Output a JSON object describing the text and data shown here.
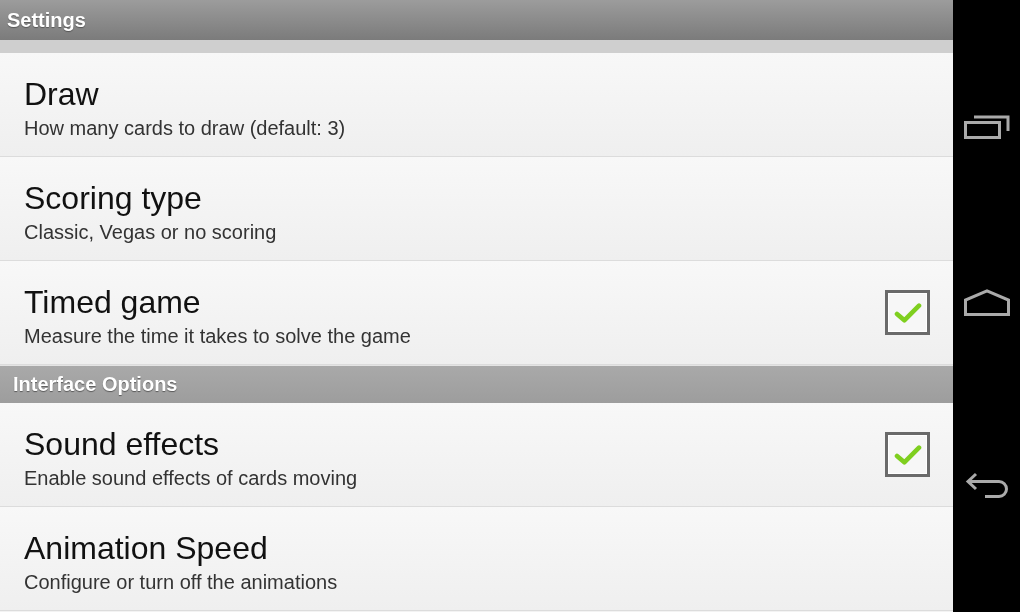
{
  "title_bar": {
    "title": "Settings"
  },
  "sections": [
    {
      "items": [
        {
          "kind": "plain",
          "title": "Draw",
          "summary": "How many cards to draw (default: 3)"
        },
        {
          "kind": "plain",
          "title": "Scoring type",
          "summary": "Classic, Vegas or no scoring"
        },
        {
          "kind": "checkbox",
          "title": "Timed game",
          "summary": "Measure the time it takes to solve the game",
          "checked": true
        }
      ]
    },
    {
      "header": "Interface Options",
      "items": [
        {
          "kind": "checkbox",
          "title": "Sound effects",
          "summary": "Enable sound effects of cards moving",
          "checked": true
        },
        {
          "kind": "plain",
          "title": "Animation Speed",
          "summary": "Configure or turn off the animations"
        }
      ]
    }
  ],
  "nav_bar": {
    "buttons": [
      {
        "kind": "recents"
      },
      {
        "kind": "home"
      },
      {
        "kind": "back"
      }
    ]
  }
}
